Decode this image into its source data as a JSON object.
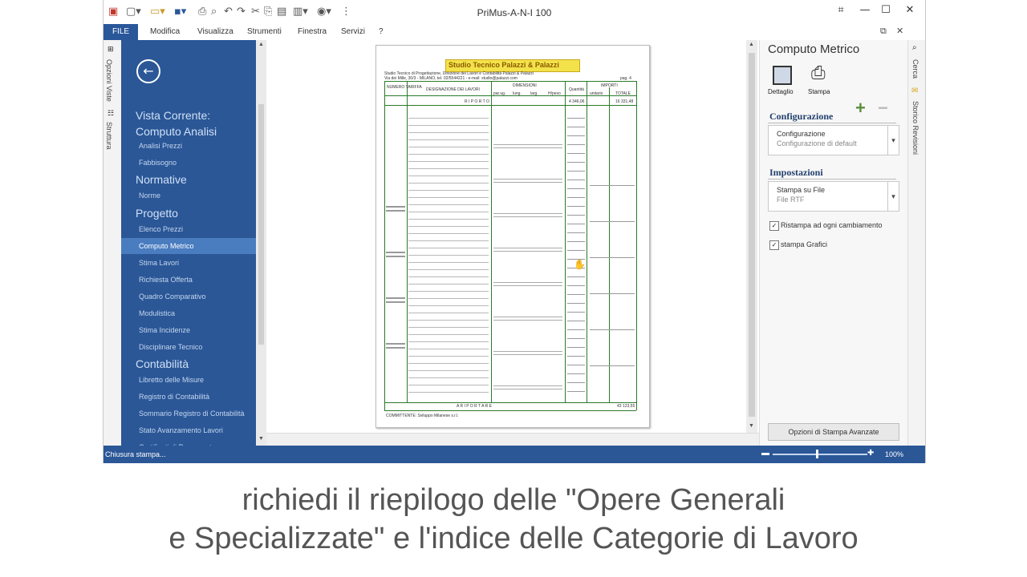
{
  "window": {
    "title": "PriMus-A-N-I   100",
    "file_tab": "FILE",
    "menu": [
      "Modifica",
      "Visualizza",
      "Strumenti",
      "Finestra",
      "Servizi",
      "?"
    ]
  },
  "left_strip": {
    "tabs": [
      "Opzioni Viste",
      "Struttura"
    ]
  },
  "nav": {
    "sections": [
      {
        "title": "Vista Corrente: Computo Analisi",
        "items": [
          "Analisi Prezzi",
          "Fabbisogno"
        ]
      },
      {
        "title": "Normative",
        "items": [
          "Norme"
        ]
      },
      {
        "title": "Progetto",
        "items": [
          "Elenco Prezzi",
          "Computo Metrico",
          "Stima Lavori",
          "Richiesta Offerta",
          "Quadro Comparativo",
          "Modulistica",
          "Stima Incidenze",
          "Disciplinare Tecnico"
        ]
      },
      {
        "title": "Contabilità",
        "items": [
          "Libretto delle Misure",
          "Registro di Contabilità",
          "Sommario Registro di Contabilità",
          "Stato Avanzamento Lavori",
          "Certificati di Pagamento"
        ]
      }
    ],
    "selected": "Computo Metrico"
  },
  "right_panel": {
    "title": "Computo Metrico",
    "buttons": [
      "Dettaglio",
      "Stampa"
    ],
    "configurazione": {
      "heading": "Configurazione",
      "label": "Configurazione",
      "value": "Configurazione di default"
    },
    "impostazioni": {
      "heading": "Impostazioni",
      "label": "Stampa su File",
      "value": "File RTF"
    },
    "checks": [
      "Ristampa ad ogni cambiamento",
      "stampa Grafici"
    ],
    "advanced_button": "Opzioni di Stampa Avanzate"
  },
  "right_strip": {
    "tabs": [
      "Cerca",
      "Storico Revisioni"
    ]
  },
  "status": {
    "text": "Chiusura stampa...",
    "zoom": "100%"
  },
  "document": {
    "logo": "Studio Tecnico Palazzi & Palazzi",
    "header_lines": [
      "Studio Tecnico di Progettazione, Direzione dei Lavori e Contabilità Palazzi & Palazzi",
      "Via dei Mille, 30/3 - MILANO, tel. 02/5544221 - e-mail: studio@palazzi.com"
    ],
    "page_label": "pag. 4",
    "col_headers": [
      "NUMERO TARIFFA",
      "DESIGNAZIONE DEI LAVORI",
      "DIMENSIONI",
      "Quantità",
      "IMPORTI"
    ],
    "sub_headers": [
      "par.ug.",
      "lung.",
      "larg.",
      "H/peso",
      "unitario",
      "TOTALE"
    ],
    "riporto": "R I P O R T O",
    "riporto_values": [
      "4 346,06",
      "16 331,48"
    ],
    "footer": "A   R I P O R T A R E",
    "footer_value": "43 123,55",
    "committente": "COMMITTENTE: Sviluppo Milanese s.r.l."
  },
  "caption": {
    "line1": "richiedi il riepilogo delle \"Opere Generali",
    "line2": "e Specializzate\" e l'indice delle Categorie di Lavoro"
  }
}
